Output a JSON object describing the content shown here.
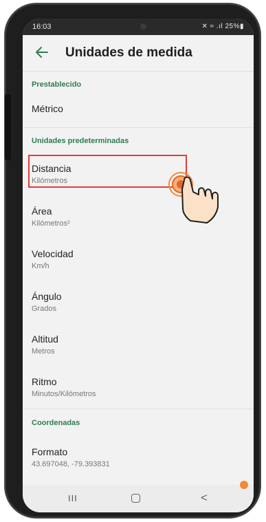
{
  "status": {
    "time": "16:03",
    "icons": "✕ ≈ .ıl 25%▮"
  },
  "appbar": {
    "title": "Unidades de medida",
    "back_icon": "arrow-left-icon"
  },
  "sections": {
    "preset": "Prestablecido",
    "defaults": "Unidades predeterminadas",
    "coords": "Coordenadas"
  },
  "preset_value": "Métrico",
  "units": [
    {
      "title": "Distancia",
      "value": "Kilómetros"
    },
    {
      "title": "Área",
      "value": "Kilómetros²"
    },
    {
      "title": "Velocidad",
      "value": "Km/h"
    },
    {
      "title": "Ángulo",
      "value": "Grados"
    },
    {
      "title": "Altitud",
      "value": "Metros"
    },
    {
      "title": "Ritmo",
      "value": "Minutos/Kilómetros"
    }
  ],
  "format": {
    "title": "Formato",
    "value": "43.697048, -79.393831"
  },
  "navbar": {
    "recents": "III",
    "back": "<"
  },
  "colors": {
    "accent": "#2e7d4f",
    "highlight": "#e53935",
    "tap": "#f28a38"
  }
}
